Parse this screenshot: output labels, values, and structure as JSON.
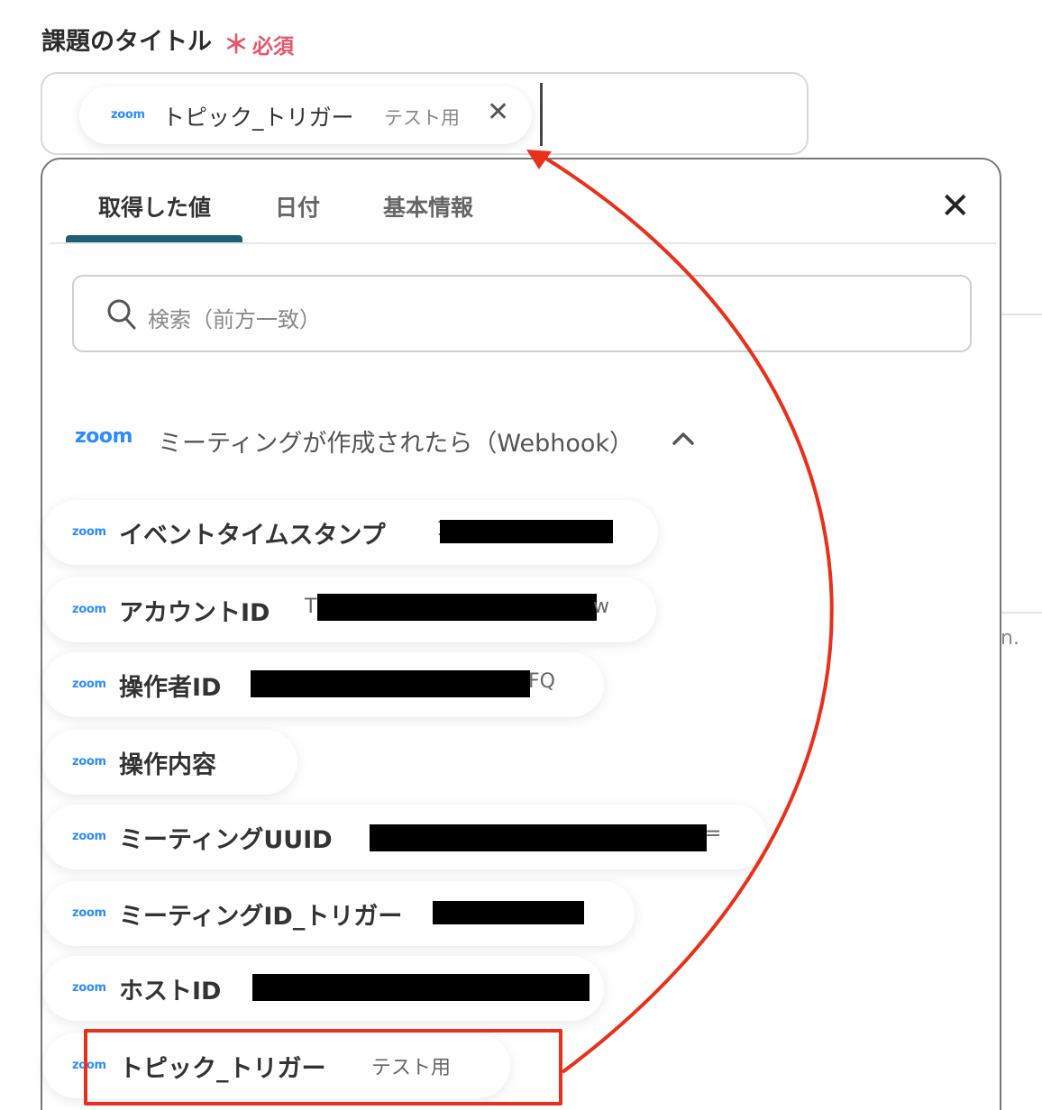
{
  "field": {
    "label": "課題のタイトル",
    "required_star": "＊",
    "required_text": "必須",
    "selected_chip": {
      "logo": "zoom",
      "label": "トピック_トリガー",
      "sub": "テスト用"
    }
  },
  "background": {
    "partial_text": "n."
  },
  "panel": {
    "tabs": [
      {
        "label": "取得した値"
      },
      {
        "label": "日付"
      },
      {
        "label": "基本情報"
      }
    ],
    "search": {
      "placeholder": "検索（前方一致）"
    },
    "section": {
      "logo": "zoom",
      "title": "ミーティングが作成されたら（Webhook）"
    },
    "items": [
      {
        "logo": "zoom",
        "label": "イベントタイムスタンプ",
        "value": "1"
      },
      {
        "logo": "zoom",
        "label": "アカウントID",
        "value": "T",
        "value_tail": "w"
      },
      {
        "logo": "zoom",
        "label": "操作者ID",
        "value": "",
        "value_tail": "FQ"
      },
      {
        "logo": "zoom",
        "label": "操作内容",
        "value": ""
      },
      {
        "logo": "zoom",
        "label": "ミーティングUUID",
        "value": "",
        "value_tail": "="
      },
      {
        "logo": "zoom",
        "label": "ミーティングID_トリガー",
        "value": ""
      },
      {
        "logo": "zoom",
        "label": "ホストID",
        "value": ""
      },
      {
        "logo": "zoom",
        "label": "トピック_トリガー",
        "value": "テスト用"
      }
    ]
  },
  "colors": {
    "accent": "#1f5f74",
    "zoom": "#2d8cff",
    "required": "#e8566a",
    "highlight": "#e8301c"
  }
}
